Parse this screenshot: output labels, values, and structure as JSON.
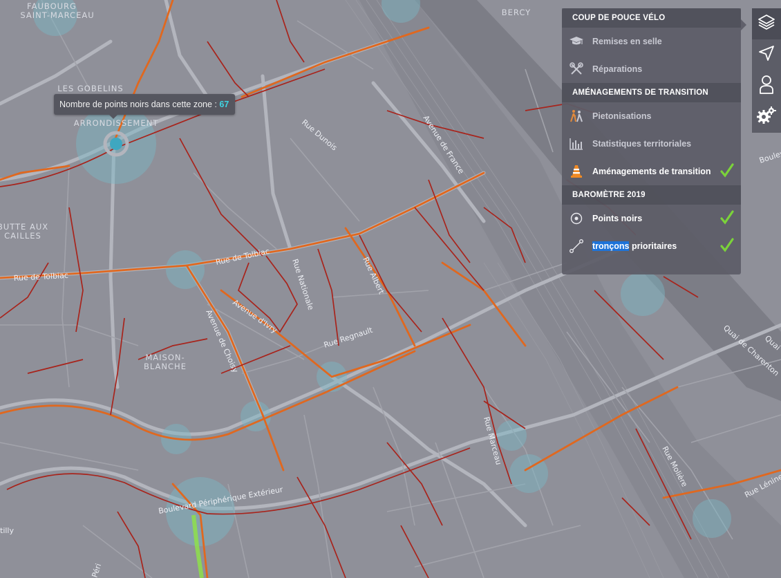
{
  "map": {
    "districts": {
      "faubourg": [
        "FAUBOURG",
        "SAINT-MARCEAU"
      ],
      "gobelins": "LES GOBELINS",
      "arrondissement": "ARRONDISSEMENT",
      "butte": [
        "BUTTE AUX",
        "CAILLES"
      ],
      "maison": [
        "MAISON-",
        "BLANCHE"
      ],
      "bercy": "BERCY"
    },
    "streets": {
      "dunois": "Rue Dunois",
      "france": "Avenue de France",
      "tolbiac_e": "Rue de Tolbiac",
      "tolbiac_w": "Rue de Tolbiac",
      "nationale": "Rue Nationale",
      "albert": "Rue Albert",
      "ivry": "Avenue d'Ivry",
      "choisy": "Avenue de Choisy",
      "regnault": "Rue Regnault",
      "peripherique": "Boulevard Périphérique Extérieur",
      "marceau": "Rue Marceau",
      "moliere": "Rue Molière",
      "lenine": "Rue Lénine",
      "charenton": "Quai de Charenton",
      "quai": "Quai",
      "boulevard_po": "Boulevard Po",
      "peri": "Péri",
      "tilly": "tilly"
    }
  },
  "tooltip": {
    "label": "Nombre de points noirs dans cette zone : ",
    "value": "67"
  },
  "panel": {
    "sections": [
      {
        "title": "COUP DE POUCE VÉLO",
        "items": [
          {
            "label": "Remises en selle",
            "icon": "graduation-cap-icon",
            "active": false
          },
          {
            "label": "Réparations",
            "icon": "tools-icon",
            "active": false
          }
        ]
      },
      {
        "title": "AMÉNAGEMENTS DE TRANSITION",
        "items": [
          {
            "label": "Pietonisations",
            "icon": "pedestrian-icon",
            "active": false
          },
          {
            "label": "Statistiques territoriales",
            "icon": "bar-chart-icon",
            "active": false
          },
          {
            "label": "Aménagements de transition",
            "icon": "traffic-cone-icon",
            "active": true
          }
        ]
      },
      {
        "title": "BAROMÈTRE 2019",
        "items": [
          {
            "label": "Points noirs",
            "icon": "target-dot-icon",
            "active": true
          },
          {
            "label_highlight": "tronçons",
            "label_rest": " prioritaires",
            "icon": "route-segment-icon",
            "active": true
          }
        ]
      }
    ]
  },
  "toolbar": [
    "layers-icon",
    "location-arrow-icon",
    "user-icon",
    "settings-icon"
  ],
  "colors": {
    "background": "#8f9099",
    "road": "#b3b5bd",
    "bike_orange": "#e0681f",
    "bike_red": "#a8231b",
    "zone_circle": "#7ab9c6",
    "check": "#7bd33a",
    "accent": "#3fd4e2"
  }
}
